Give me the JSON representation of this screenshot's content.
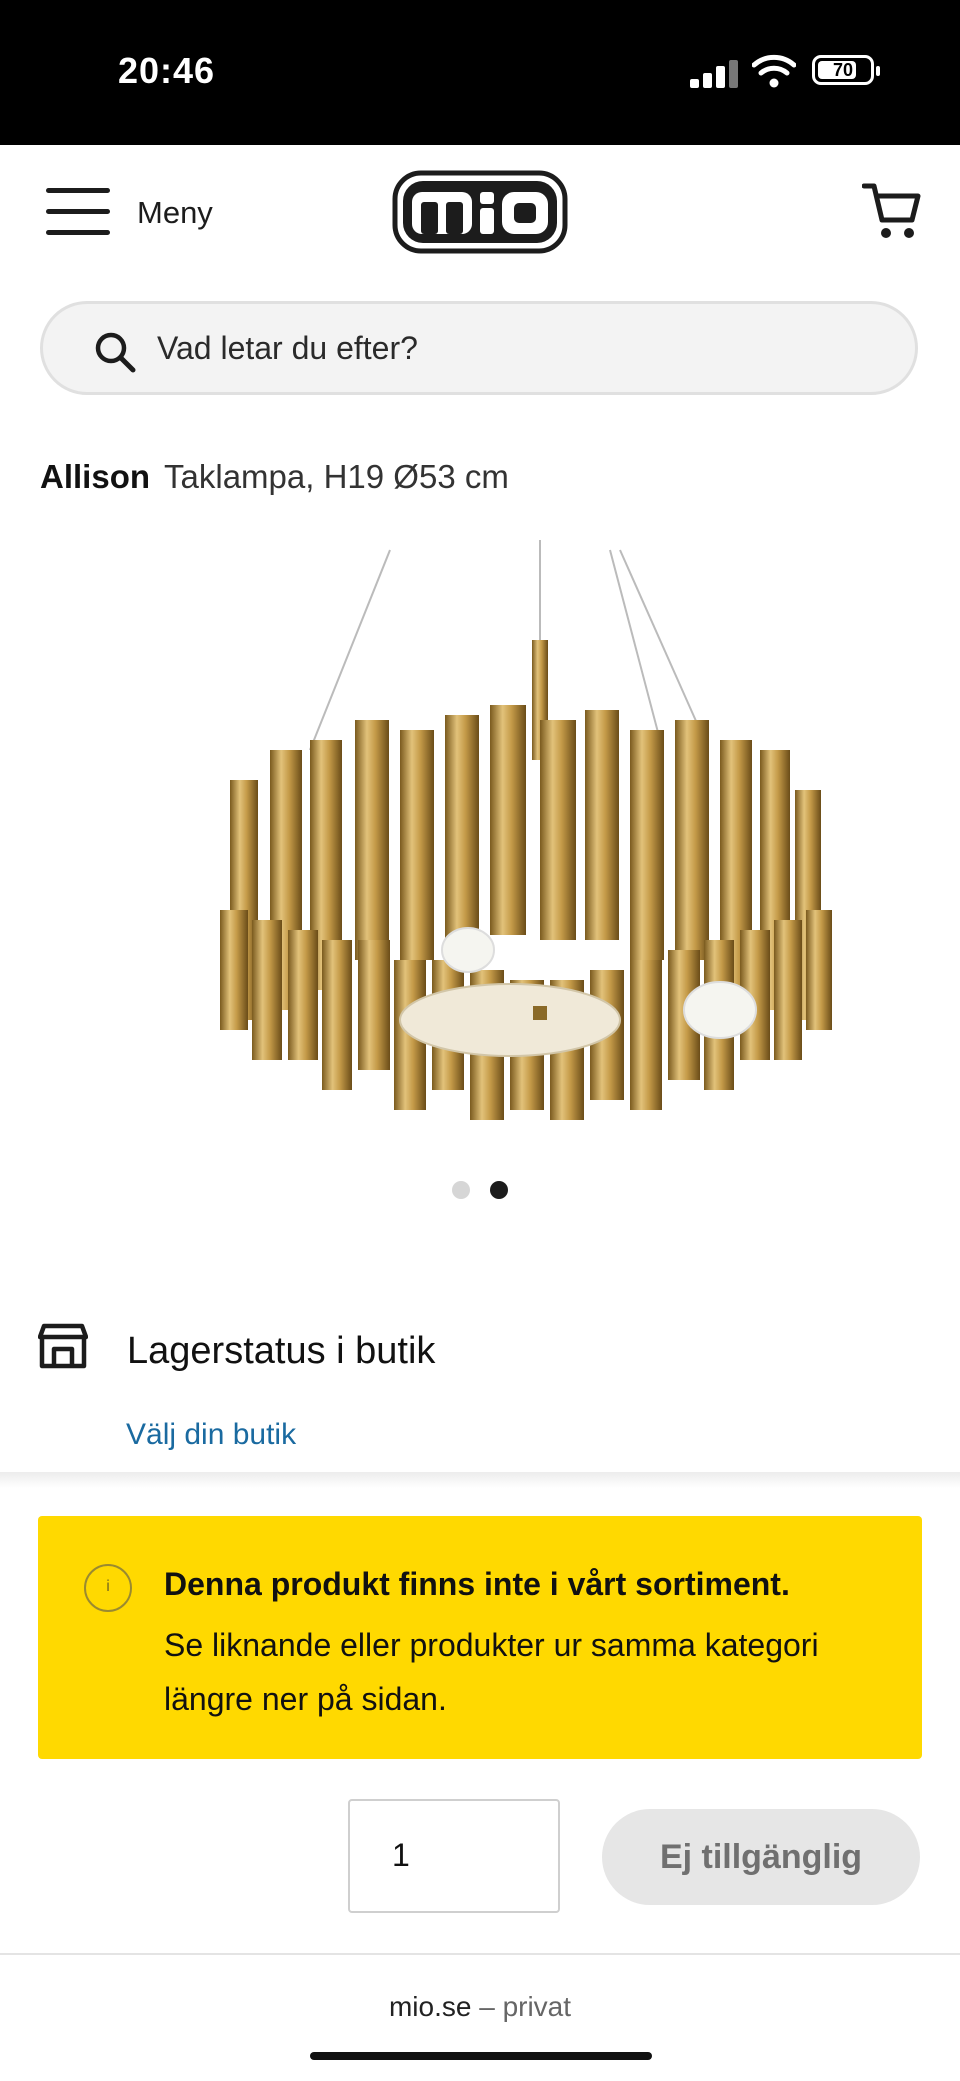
{
  "status_bar": {
    "time": "20:46",
    "battery": "70"
  },
  "header": {
    "menu_label": "Meny",
    "logo_text": "mio"
  },
  "search": {
    "placeholder": "Vad letar du efter?"
  },
  "product": {
    "name": "Allison",
    "description": "Taklampa, H19 Ø53 cm",
    "image_count": 2,
    "active_image": 2
  },
  "store_stock": {
    "title": "Lagerstatus i butik",
    "link": "Välj din butik"
  },
  "notice": {
    "title": "Denna produkt finns inte i vårt sortiment.",
    "body": "Se liknande eller produkter ur samma kategori längre ner på sidan.",
    "color": "#ffd900"
  },
  "purchase": {
    "quantity": "1",
    "button_label": "Ej tillgänglig"
  },
  "browser": {
    "domain": "mio.se",
    "separator": "–",
    "mode": "privat"
  },
  "icons": [
    "hamburger-icon",
    "cart-icon",
    "search-icon",
    "store-icon",
    "info-icon",
    "signal-icon",
    "wifi-icon",
    "battery-icon"
  ]
}
